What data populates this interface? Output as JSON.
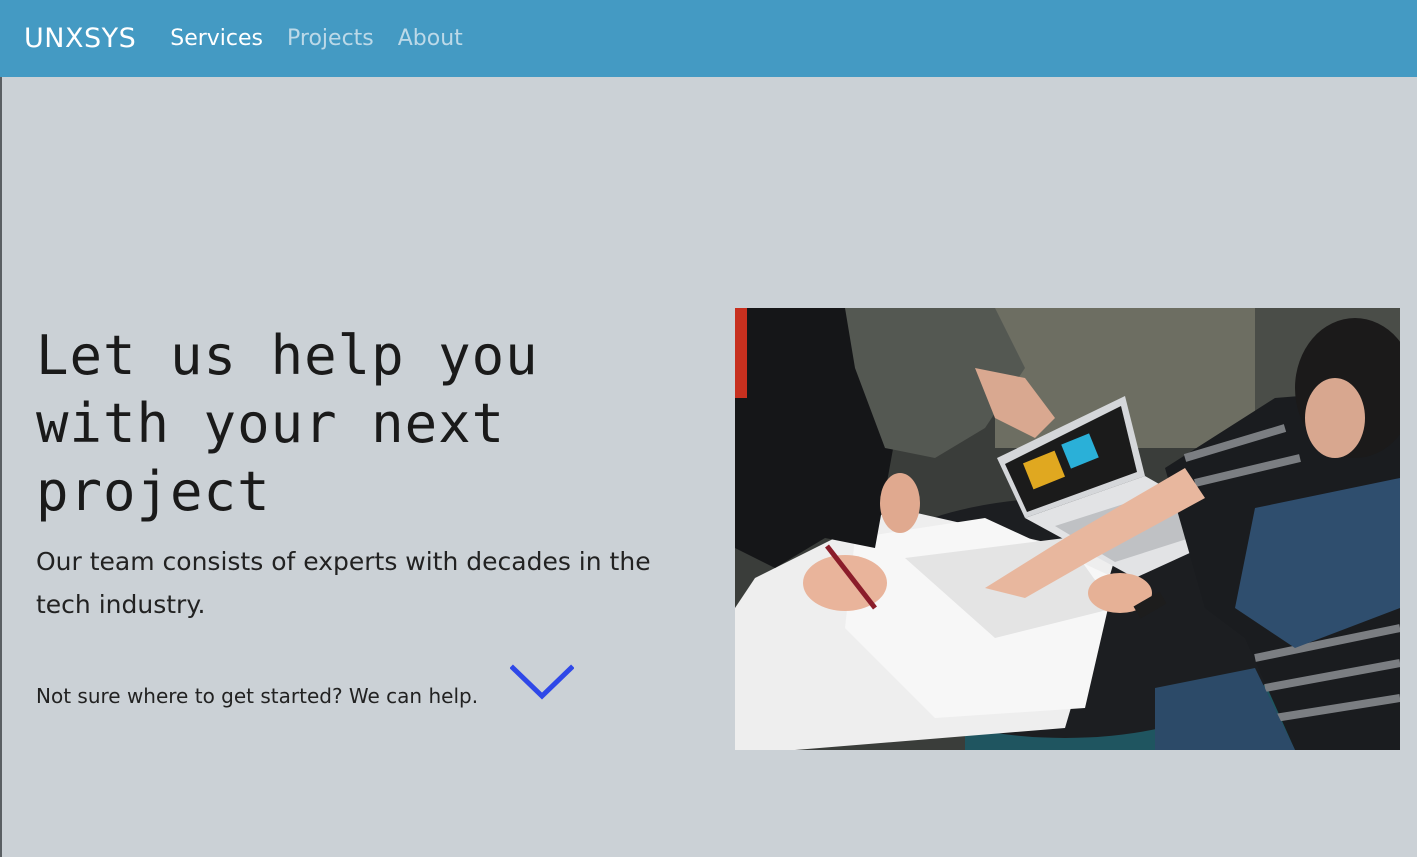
{
  "nav": {
    "brand": "UNXSYS",
    "links": [
      {
        "label": "Services",
        "active": true
      },
      {
        "label": "Projects",
        "active": false
      },
      {
        "label": "About",
        "active": false
      }
    ]
  },
  "hero": {
    "title": "Let us help you with your next project",
    "subtitle": "Our team consists of experts with decades in the tech industry.",
    "help_text": "Not sure where to get started? We can help.",
    "scroll_icon": "chevron-down-icon"
  },
  "colors": {
    "navbar": "#449ac3",
    "background": "#cbd1d6",
    "chevron": "#2f48e8"
  }
}
